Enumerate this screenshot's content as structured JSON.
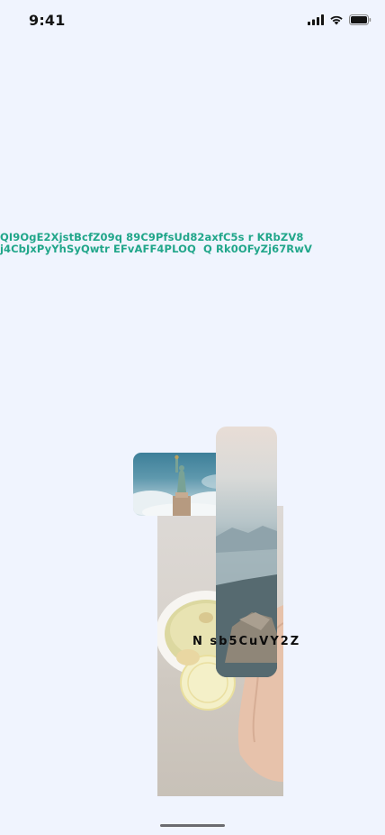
{
  "status_bar": {
    "time": "9:41",
    "icons": [
      "signal-icon",
      "wifi-icon",
      "battery-icon"
    ]
  },
  "content": {
    "code_lines": [
      "QI9OgE2XjstBcfZ09q 89C9PfsUd82axfC5s r KRbZV8",
      "j4CbJxPyYhSyQwtr EFvAFF4PLOQ  Q Rk0OFyZj67RwV"
    ],
    "overlay_label": "N sb5CuVY2Z",
    "accent_color": "#21a68a",
    "images": [
      "tea-lemon-image",
      "statue-of-liberty-image",
      "mountain-coast-image"
    ]
  }
}
